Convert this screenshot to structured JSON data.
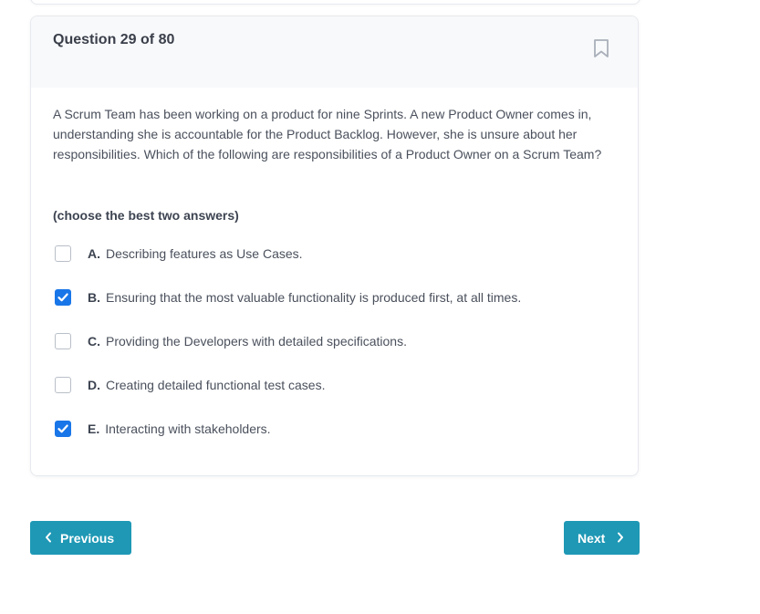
{
  "question": {
    "title": "Question 29 of 80",
    "text": "A Scrum Team has been working on a product for nine Sprints. A new Product Owner comes in, understanding she is accountable for the Product Backlog. However, she is unsure about her responsibilities. Which of the following are responsibilities of a Product Owner on a Scrum Team?",
    "instruction": "(choose the best two answers)",
    "bookmark_icon": "bookmark-icon"
  },
  "options": [
    {
      "letter": "A.",
      "text": "Describing features as Use Cases.",
      "checked": false
    },
    {
      "letter": "B.",
      "text": "Ensuring that the most valuable functionality is produced first, at all times.",
      "checked": true
    },
    {
      "letter": "C.",
      "text": "Providing the Developers with detailed specifications.",
      "checked": false
    },
    {
      "letter": "D.",
      "text": "Creating detailed functional test cases.",
      "checked": false
    },
    {
      "letter": "E.",
      "text": "Interacting with stakeholders.",
      "checked": true
    }
  ],
  "nav": {
    "previous_label": "Previous",
    "next_label": "Next"
  },
  "colors": {
    "accent": "#1e98b5",
    "checkbox_checked": "#1976e8"
  }
}
